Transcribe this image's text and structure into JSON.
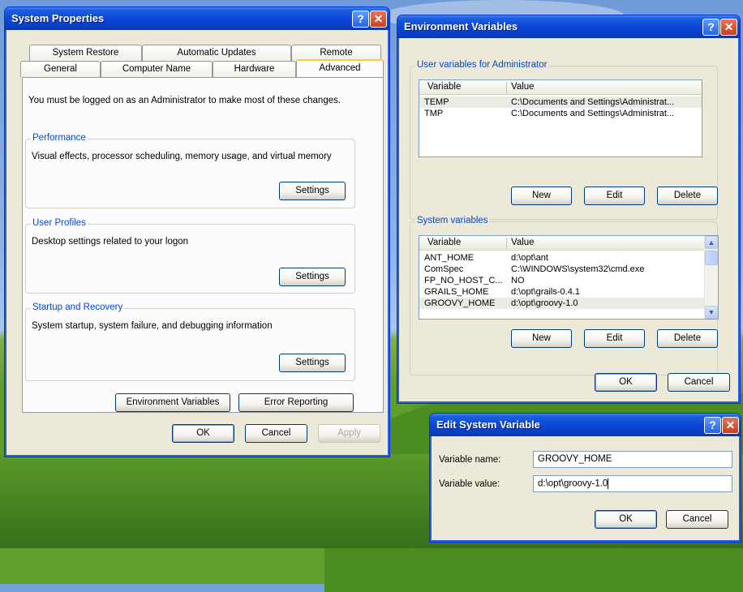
{
  "system_properties": {
    "title": "System Properties",
    "tabs_row1": [
      "System Restore",
      "Automatic Updates",
      "Remote"
    ],
    "tabs_row2": [
      "General",
      "Computer Name",
      "Hardware",
      "Advanced"
    ],
    "admin_notice": "You must be logged on as an Administrator to make most of these changes.",
    "performance": {
      "title": "Performance",
      "desc": "Visual effects, processor scheduling, memory usage, and virtual memory",
      "button": "Settings"
    },
    "user_profiles": {
      "title": "User Profiles",
      "desc": "Desktop settings related to your logon",
      "button": "Settings"
    },
    "startup_recovery": {
      "title": "Startup and Recovery",
      "desc": "System startup, system failure, and debugging information",
      "button": "Settings"
    },
    "env_button": "Environment Variables",
    "error_button": "Error Reporting",
    "ok": "OK",
    "cancel": "Cancel",
    "apply": "Apply"
  },
  "environment_variables": {
    "title": "Environment Variables",
    "user_group_title": "User variables for Administrator",
    "columns": [
      "Variable",
      "Value"
    ],
    "user_vars": [
      {
        "name": "TEMP",
        "value": "C:\\Documents and Settings\\Administrat..."
      },
      {
        "name": "TMP",
        "value": "C:\\Documents and Settings\\Administrat..."
      }
    ],
    "system_group_title": "System variables",
    "system_vars": [
      {
        "name": "ANT_HOME",
        "value": "d:\\opt\\ant"
      },
      {
        "name": "ComSpec",
        "value": "C:\\WINDOWS\\system32\\cmd.exe"
      },
      {
        "name": "FP_NO_HOST_C...",
        "value": "NO"
      },
      {
        "name": "GRAILS_HOME",
        "value": "d:\\opt\\grails-0.4.1"
      },
      {
        "name": "GROOVY_HOME",
        "value": "d:\\opt\\groovy-1.0"
      }
    ],
    "new": "New",
    "edit": "Edit",
    "delete": "Delete",
    "ok": "OK",
    "cancel": "Cancel"
  },
  "edit_system_variable": {
    "title": "Edit System Variable",
    "name_label": "Variable name:",
    "name_value": "GROOVY_HOME",
    "value_label": "Variable value:",
    "value_value": "d:\\opt\\groovy-1.0",
    "ok": "OK",
    "cancel": "Cancel"
  },
  "titlebar_buttons": {
    "help": "?",
    "close": "✕"
  },
  "colors": {
    "titlebar": "#0a46d8",
    "dialog_bg": "#ece9d8",
    "group_title": "#0046d5",
    "tab_highlight": "#ffc83c"
  }
}
